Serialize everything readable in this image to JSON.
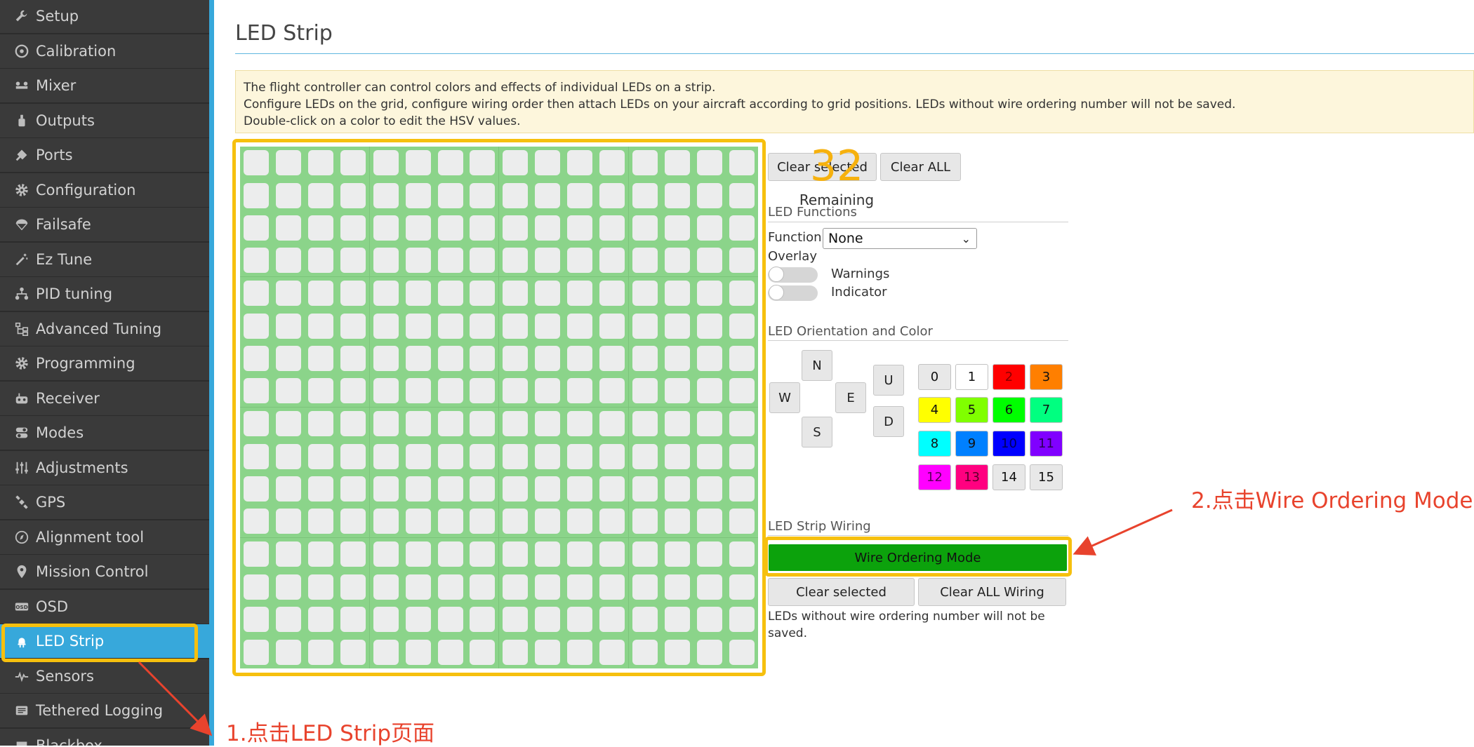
{
  "sidebar": {
    "items": [
      {
        "label": "Setup",
        "icon": "wrench-icon",
        "active": false
      },
      {
        "label": "Calibration",
        "icon": "target-icon",
        "active": false
      },
      {
        "label": "Mixer",
        "icon": "mixer-icon",
        "active": false
      },
      {
        "label": "Outputs",
        "icon": "outputs-icon",
        "active": false
      },
      {
        "label": "Ports",
        "icon": "plug-icon",
        "active": false
      },
      {
        "label": "Configuration",
        "icon": "gear-icon",
        "active": false
      },
      {
        "label": "Failsafe",
        "icon": "parachute-icon",
        "active": false
      },
      {
        "label": "Ez Tune",
        "icon": "wand-icon",
        "active": false
      },
      {
        "label": "PID tuning",
        "icon": "pid-icon",
        "active": false
      },
      {
        "label": "Advanced Tuning",
        "icon": "tree-icon",
        "active": false
      },
      {
        "label": "Programming",
        "icon": "gear-icon",
        "active": false
      },
      {
        "label": "Receiver",
        "icon": "receiver-icon",
        "active": false
      },
      {
        "label": "Modes",
        "icon": "toggle-icon",
        "active": false
      },
      {
        "label": "Adjustments",
        "icon": "sliders-icon",
        "active": false
      },
      {
        "label": "GPS",
        "icon": "satellite-icon",
        "active": false
      },
      {
        "label": "Alignment tool",
        "icon": "compass-icon",
        "active": false
      },
      {
        "label": "Mission Control",
        "icon": "map-pin-icon",
        "active": false
      },
      {
        "label": "OSD",
        "icon": "osd-icon",
        "active": false
      },
      {
        "label": "LED Strip",
        "icon": "led-icon",
        "active": true
      },
      {
        "label": "Sensors",
        "icon": "pulse-icon",
        "active": false
      },
      {
        "label": "Tethered Logging",
        "icon": "log-icon",
        "active": false
      },
      {
        "label": "Blackbox",
        "icon": "blackbox-icon",
        "active": false
      }
    ]
  },
  "page": {
    "title": "LED Strip",
    "note_lines": [
      "The flight controller can control colors and effects of individual LEDs on a strip.",
      "Configure LEDs on the grid, configure wiring order then attach LEDs on your aircraft according to grid positions. LEDs without wire ordering number will not be saved.",
      "Double-click on a color to edit the HSV values."
    ]
  },
  "grid": {
    "rows": 16,
    "cols": 16
  },
  "controls": {
    "clear_selected": "Clear selected",
    "clear_all": "Clear ALL",
    "remaining_count": "32",
    "remaining_label": "Remaining"
  },
  "functions": {
    "section_title": "LED Functions",
    "function_label": "Function",
    "function_value": "None",
    "overlay_label": "Overlay",
    "overlays": [
      {
        "label": "Warnings",
        "on": false
      },
      {
        "label": "Indicator",
        "on": false
      }
    ]
  },
  "orientation": {
    "section_title": "LED Orientation and Color",
    "directions": {
      "n": "N",
      "w": "W",
      "e": "E",
      "s": "S",
      "u": "U",
      "d": "D"
    },
    "colors": [
      {
        "label": "0",
        "bg": "#e8e8e8",
        "fg": "#111111"
      },
      {
        "label": "1",
        "bg": "#ffffff",
        "fg": "#111111"
      },
      {
        "label": "2",
        "bg": "#ff0000",
        "fg": "#8a0000"
      },
      {
        "label": "3",
        "bg": "#ff7f00",
        "fg": "#111111"
      },
      {
        "label": "4",
        "bg": "#ffff00",
        "fg": "#111111"
      },
      {
        "label": "5",
        "bg": "#80ff00",
        "fg": "#111111"
      },
      {
        "label": "6",
        "bg": "#00ff00",
        "fg": "#111111"
      },
      {
        "label": "7",
        "bg": "#00ff80",
        "fg": "#111111"
      },
      {
        "label": "8",
        "bg": "#00ffff",
        "fg": "#111111"
      },
      {
        "label": "9",
        "bg": "#0080ff",
        "fg": "#111111"
      },
      {
        "label": "10",
        "bg": "#0000ff",
        "fg": "#00005a"
      },
      {
        "label": "11",
        "bg": "#8000ff",
        "fg": "#2a0055"
      },
      {
        "label": "12",
        "bg": "#ff00ff",
        "fg": "#5a005a"
      },
      {
        "label": "13",
        "bg": "#ff0080",
        "fg": "#5a002a"
      },
      {
        "label": "14",
        "bg": "#e8e8e8",
        "fg": "#111111"
      },
      {
        "label": "15",
        "bg": "#e8e8e8",
        "fg": "#111111"
      }
    ]
  },
  "wiring": {
    "section_title": "LED Strip Wiring",
    "wire_mode": "Wire Ordering Mode",
    "clear_selected": "Clear selected",
    "clear_all_wiring": "Clear ALL Wiring",
    "note_line1": "LEDs without wire ordering number will not be",
    "note_line2": "saved."
  },
  "annotations": {
    "step1": "1.点击LED Strip页面",
    "step2": "2.点击Wire Ordering Mode"
  },
  "colors": {
    "accent": "#37a8db",
    "highlight": "#f6c00e",
    "annotation": "#e8432d",
    "wire_button": "#0ca20c",
    "grid_bg": "#8bd48a",
    "remaining": "#f6b10e"
  }
}
